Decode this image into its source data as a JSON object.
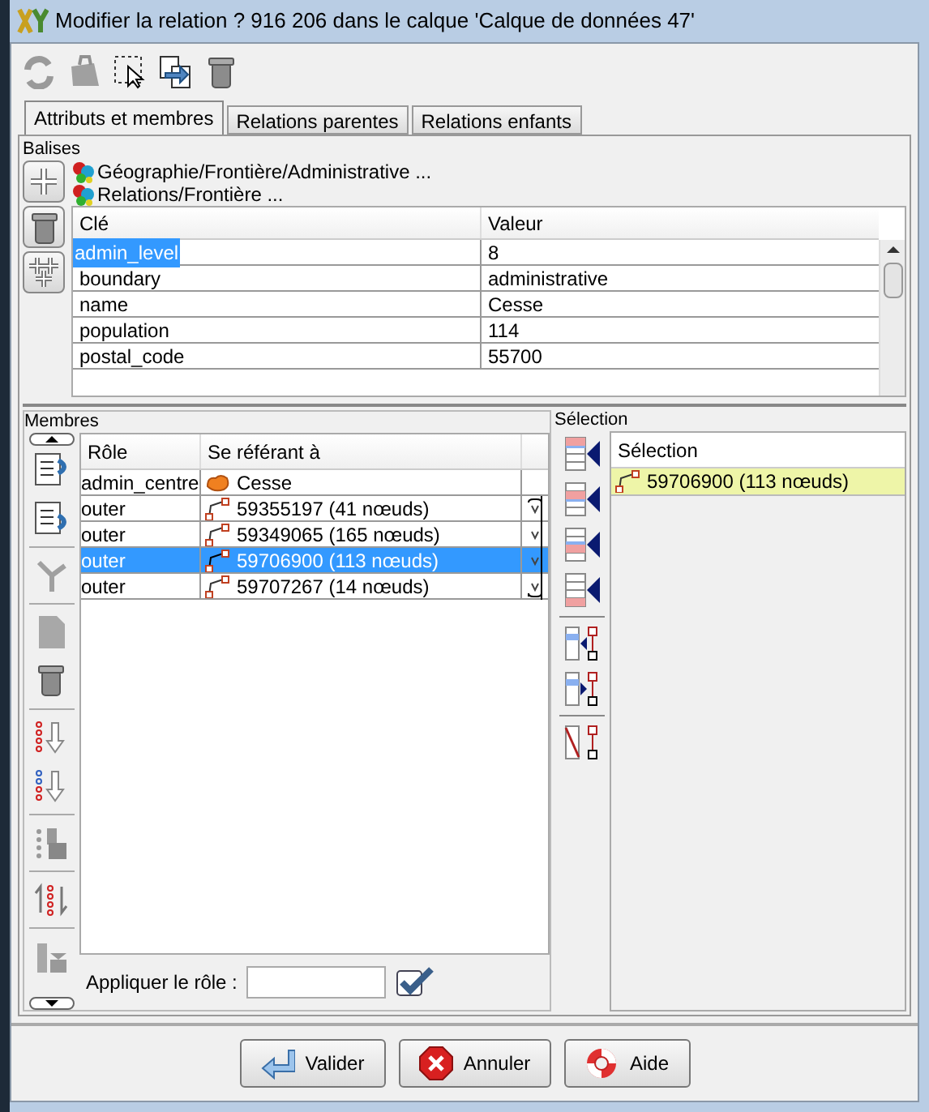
{
  "window": {
    "title": "Modifier la relation ? 916 206 dans le calque 'Calque de données 47'"
  },
  "tabs": [
    {
      "label": "Attributs et membres",
      "selected": true
    },
    {
      "label": "Relations parentes",
      "selected": false
    },
    {
      "label": "Relations enfants",
      "selected": false
    }
  ],
  "tags": {
    "label": "Balises",
    "presets": [
      "Géographie/Frontière/Administrative ...",
      "Relations/Frontière ..."
    ],
    "columns": [
      "Clé",
      "Valeur"
    ],
    "rows": [
      {
        "key": "admin_level",
        "value": "8",
        "selected": true
      },
      {
        "key": "boundary",
        "value": "administrative",
        "selected": false
      },
      {
        "key": "name",
        "value": "Cesse",
        "selected": false
      },
      {
        "key": "population",
        "value": "114",
        "selected": false
      },
      {
        "key": "postal_code",
        "value": "55700",
        "selected": false
      }
    ]
  },
  "members": {
    "label": "Membres",
    "columns": [
      "Rôle",
      "Se référant à"
    ],
    "rows": [
      {
        "role": "admin_centre",
        "kind": "area",
        "ref": "Cesse",
        "selected": false
      },
      {
        "role": "outer",
        "kind": "way",
        "ref": "59355197 (41 nœuds)",
        "selected": false
      },
      {
        "role": "outer",
        "kind": "way",
        "ref": "59349065 (165 nœuds)",
        "selected": false
      },
      {
        "role": "outer",
        "kind": "way",
        "ref": "59706900 (113 nœuds)",
        "selected": true
      },
      {
        "role": "outer",
        "kind": "way",
        "ref": "59707267 (14 nœuds)",
        "selected": false
      }
    ],
    "apply_role": {
      "label": "Appliquer le rôle :"
    }
  },
  "selection": {
    "label": "Sélection",
    "column": "Sélection",
    "rows": [
      {
        "kind": "way",
        "ref": "59706900 (113 nœuds)"
      }
    ]
  },
  "buttons": [
    {
      "kind": "ok",
      "label": "Valider"
    },
    {
      "kind": "cancel",
      "label": "Annuler"
    },
    {
      "kind": "help",
      "label": "Aide"
    }
  ]
}
